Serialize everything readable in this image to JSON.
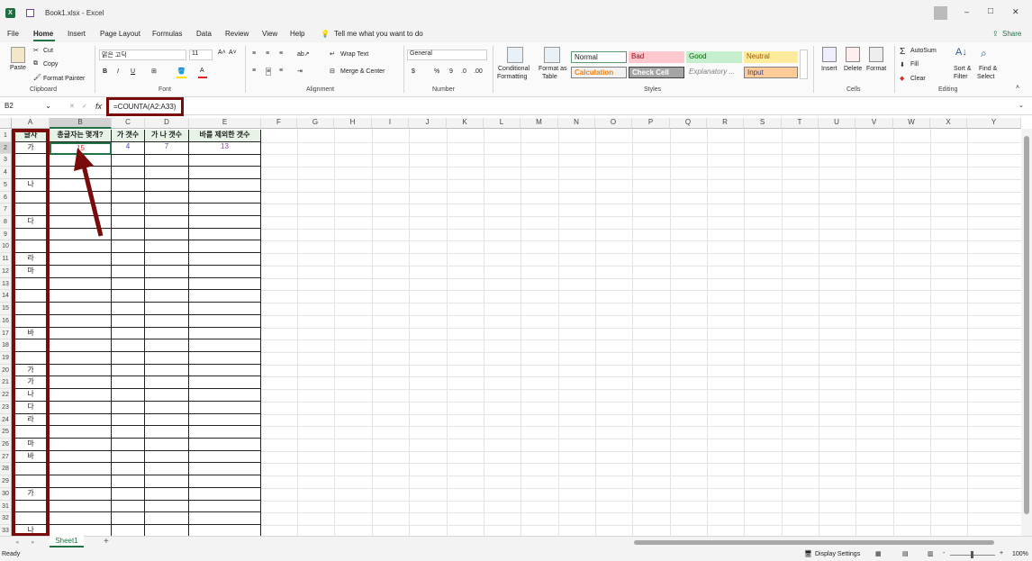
{
  "titlebar": {
    "save_icon": "save-icon",
    "filename": "Book1.xlsx",
    "separator": "-",
    "app": "Excel",
    "min": "–",
    "max": "□",
    "close": "✕"
  },
  "menu": {
    "items": [
      "File",
      "Home",
      "Insert",
      "Page Layout",
      "Formulas",
      "Data",
      "Review",
      "View",
      "Help"
    ],
    "tell": "Tell me what you want to do",
    "share": "Share"
  },
  "ribbon": {
    "clipboard": {
      "paste": "Paste",
      "cut": "Cut",
      "copy": "Copy",
      "format_painter": "Format Painter",
      "label": "Clipboard"
    },
    "font": {
      "name": "맑은 고딕",
      "size": "11",
      "bold": "B",
      "italic": "I",
      "underline": "U",
      "label": "Font"
    },
    "alignment": {
      "wrap": "Wrap Text",
      "merge": "Merge & Center",
      "label": "Alignment"
    },
    "number": {
      "format": "General",
      "label": "Number",
      "dollar": "$",
      "pct": "%",
      "comma": "9"
    },
    "styles": {
      "conditional": "Conditional",
      "formatting": "Formatting",
      "format_as": "Format as",
      "table": "Table",
      "normal": "Normal",
      "bad": "Bad",
      "good": "Good",
      "neutral": "Neutral",
      "calculation": "Calculation",
      "check_cell": "Check Cell",
      "explanatory": "Explanatory ...",
      "input": "Input",
      "label": "Styles"
    },
    "cells": {
      "insert": "Insert",
      "delete": "Delete",
      "format": "Format",
      "label": "Cells"
    },
    "editing": {
      "autosum": "AutoSum",
      "fill": "Fill",
      "clear": "Clear",
      "sort": "Sort &",
      "filter": "Filter",
      "find": "Find &",
      "select": "Select",
      "label": "Editing"
    }
  },
  "formula_bar": {
    "name_box": "B2",
    "fx": "fx",
    "formula": "=COUNTA(A2:A33)"
  },
  "columns": [
    "A",
    "B",
    "C",
    "D",
    "E",
    "F",
    "G",
    "H",
    "I",
    "J",
    "K",
    "L",
    "M",
    "N",
    "O",
    "P",
    "Q",
    "R",
    "S",
    "T",
    "U",
    "V",
    "W",
    "X",
    "Y"
  ],
  "rows": [
    "1",
    "2",
    "3",
    "4",
    "5",
    "6",
    "7",
    "8",
    "9",
    "10",
    "11",
    "12",
    "13",
    "14",
    "15",
    "16",
    "17",
    "18",
    "19",
    "20",
    "21",
    "22",
    "23",
    "24",
    "25",
    "26",
    "27",
    "28",
    "29",
    "30",
    "31",
    "32",
    "33"
  ],
  "headers": {
    "a1": "글자",
    "b1": "총글자는 몇개?",
    "c1": "가 갯수",
    "d1": "가 나 갯수",
    "e1": "바를 제외한 갯수"
  },
  "values": {
    "b2": "15",
    "c2": "4",
    "d2": "7",
    "e2": "13"
  },
  "column_a": [
    "가",
    "",
    "",
    "나",
    "",
    "",
    "다",
    "",
    "",
    "라",
    "마",
    "",
    "",
    "",
    "",
    "바",
    "",
    "",
    "가",
    "가",
    "나",
    "다",
    "라",
    "",
    "마",
    "바",
    "",
    "",
    "가",
    "",
    "",
    "나"
  ],
  "sheet": {
    "tab": "Sheet1",
    "add": "+"
  },
  "status": {
    "ready": "Ready",
    "display_settings": "Display Settings",
    "zoom": "100%",
    "minus": "-",
    "plus": "+"
  },
  "colors": {
    "accent_green": "#217346",
    "annotation": "#7a0b0b",
    "red_value": "#e03030",
    "blue_value": "#4a4aa8",
    "purple_value": "#8b3ab0"
  }
}
